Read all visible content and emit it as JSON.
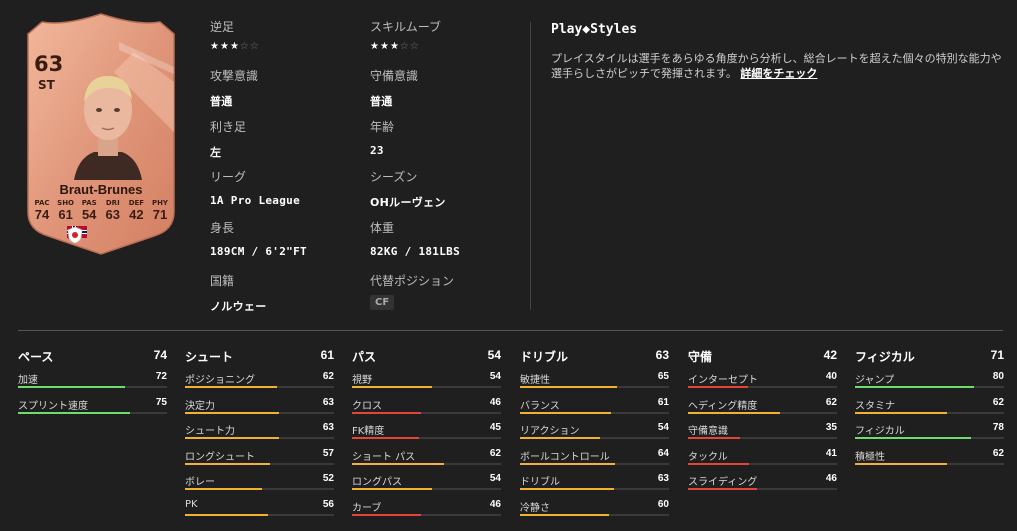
{
  "card": {
    "rating": "63",
    "position": "ST",
    "name": "Braut-Brunes",
    "stats": [
      {
        "key": "PAC",
        "value": "74"
      },
      {
        "key": "SHO",
        "value": "61"
      },
      {
        "key": "PAS",
        "value": "54"
      },
      {
        "key": "DRI",
        "value": "63"
      },
      {
        "key": "DEF",
        "value": "42"
      },
      {
        "key": "PHY",
        "value": "71"
      }
    ],
    "colors": {
      "card": "#e49b7b",
      "text": "#3a1d12"
    }
  },
  "info": {
    "weak_foot": {
      "label": "逆足",
      "stars": 3,
      "max": 5
    },
    "skill_moves": {
      "label": "スキルムーブ",
      "stars": 3,
      "max": 5
    },
    "attack_wr": {
      "label": "攻撃意識",
      "value": "普通"
    },
    "defense_wr": {
      "label": "守備意識",
      "value": "普通"
    },
    "foot": {
      "label": "利き足",
      "value": "左"
    },
    "age": {
      "label": "年齢",
      "value": "23"
    },
    "league": {
      "label": "リーグ",
      "value": "1A Pro League"
    },
    "club": {
      "label": "シーズン",
      "value": "OHルーヴェン"
    },
    "height": {
      "label": "身長",
      "value": "189CM / 6'2\"FT"
    },
    "weight": {
      "label": "体重",
      "value": "82KG / 181LBS"
    },
    "nation": {
      "label": "国籍",
      "value": "ノルウェー"
    },
    "alt_pos": {
      "label": "代替ポジション",
      "value": "CF"
    }
  },
  "playstyles": {
    "title": "Play◆Styles",
    "desc": "プレイスタイルは選手をあらゆる角度から分析し、総合レートを超えた個々の特別な能力や選手らしさがピッチで発揮されます。",
    "link": "詳細をチェック"
  },
  "attributes": [
    {
      "name": "ペース",
      "value": "74",
      "items": [
        {
          "label": "加速",
          "value": 72
        },
        {
          "label": "スプリント速度",
          "value": 75
        }
      ]
    },
    {
      "name": "シュート",
      "value": "61",
      "items": [
        {
          "label": "ポジショニング",
          "value": 62
        },
        {
          "label": "決定力",
          "value": 63
        },
        {
          "label": "シュート力",
          "value": 63
        },
        {
          "label": "ロングシュート",
          "value": 57
        },
        {
          "label": "ボレー",
          "value": 52
        },
        {
          "label": "PK",
          "value": 56
        }
      ]
    },
    {
      "name": "パス",
      "value": "54",
      "items": [
        {
          "label": "視野",
          "value": 54
        },
        {
          "label": "クロス",
          "value": 46
        },
        {
          "label": "FK精度",
          "value": 45
        },
        {
          "label": "ショート パス",
          "value": 62
        },
        {
          "label": "ロングパス",
          "value": 54
        },
        {
          "label": "カーブ",
          "value": 46
        }
      ]
    },
    {
      "name": "ドリブル",
      "value": "63",
      "items": [
        {
          "label": "敏捷性",
          "value": 65
        },
        {
          "label": "バランス",
          "value": 61
        },
        {
          "label": "リアクション",
          "value": 54
        },
        {
          "label": "ボールコントロール",
          "value": 64
        },
        {
          "label": "ドリブル",
          "value": 63
        },
        {
          "label": "冷静さ",
          "value": 60
        }
      ]
    },
    {
      "name": "守備",
      "value": "42",
      "items": [
        {
          "label": "インターセプト",
          "value": 40
        },
        {
          "label": "ヘディング精度",
          "value": 62
        },
        {
          "label": "守備意識",
          "value": 35
        },
        {
          "label": "タックル",
          "value": 41
        },
        {
          "label": "スライディング",
          "value": 46
        }
      ]
    },
    {
      "name": "フィジカル",
      "value": "71",
      "items": [
        {
          "label": "ジャンプ",
          "value": 80
        },
        {
          "label": "スタミナ",
          "value": 62
        },
        {
          "label": "フィジカル",
          "value": 78
        },
        {
          "label": "積極性",
          "value": 62
        }
      ]
    }
  ],
  "bar_colors": {
    "high": "#6fdc6f",
    "mid": "#f2b134",
    "low": "#e2463a"
  }
}
